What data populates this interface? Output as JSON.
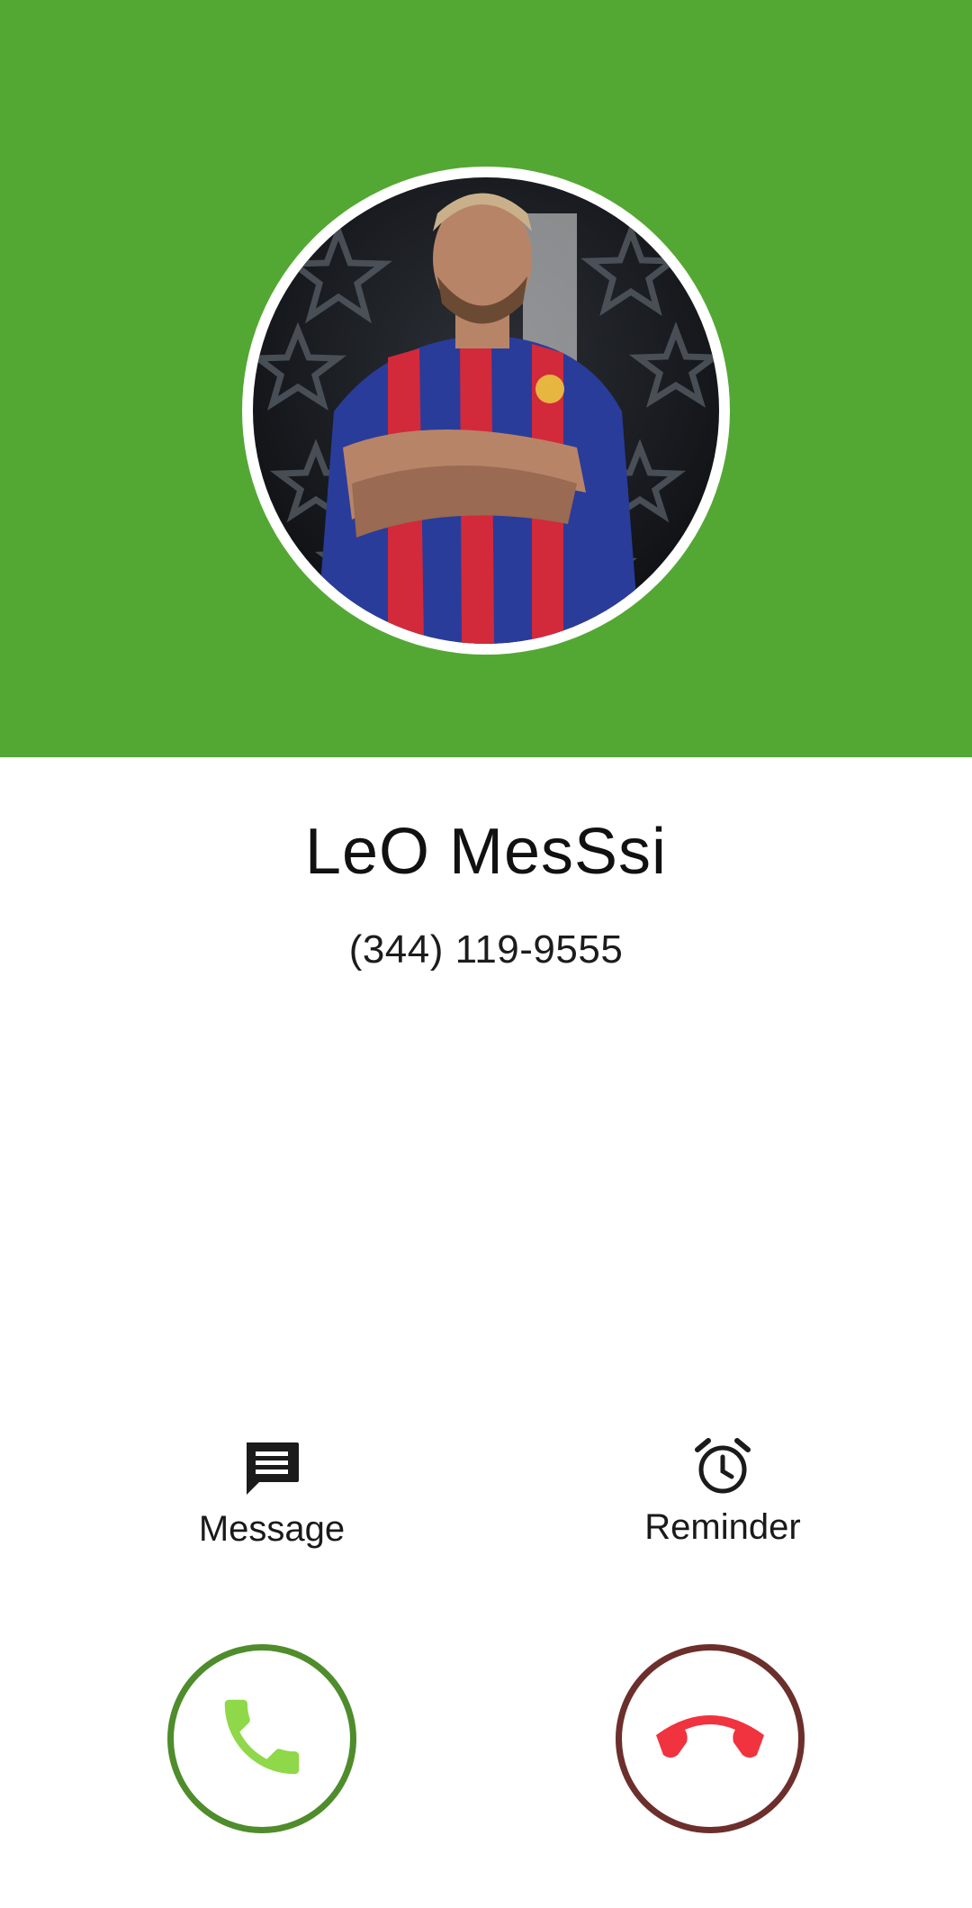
{
  "colors": {
    "header_green": "#53a834",
    "answer_ring": "#4f8c2c",
    "answer_icon": "#8ed84a",
    "decline_ring": "#6c2f2c",
    "decline_icon": "#f0333f"
  },
  "contact": {
    "photo_icon": "contact-photo",
    "name": "LeO MesSsi",
    "number": "(344) 119-9555"
  },
  "actions": {
    "message": {
      "label": "Message",
      "icon": "message-icon"
    },
    "reminder": {
      "label": "Reminder",
      "icon": "alarm-clock-icon"
    }
  },
  "buttons": {
    "answer": {
      "icon": "phone-answer-icon"
    },
    "decline": {
      "icon": "phone-hangup-icon"
    }
  }
}
